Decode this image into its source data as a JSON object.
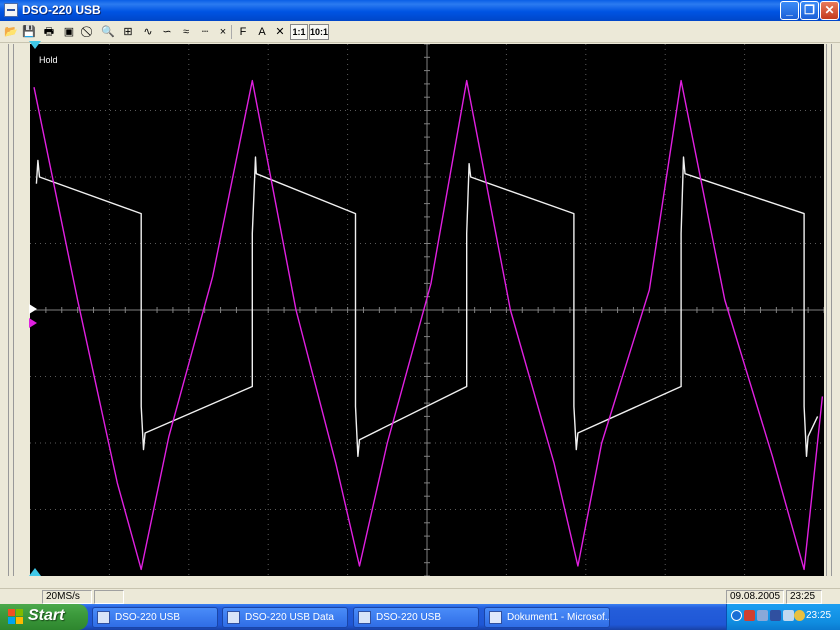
{
  "window": {
    "title": "DSO-220 USB",
    "buttons": {
      "minimize": "_",
      "maximize": "❐",
      "close": "✕"
    }
  },
  "toolbar": {
    "items": [
      {
        "icon": "open-folder-icon",
        "glyph": "📂"
      },
      {
        "icon": "save-icon",
        "glyph": "💾"
      },
      {
        "icon": "print-icon",
        "glyph": "🖶"
      },
      {
        "icon": "device-icon",
        "glyph": "▣"
      },
      {
        "icon": "stop-icon",
        "glyph": "⃠"
      },
      {
        "icon": "zoom-icon",
        "glyph": "🔍"
      },
      {
        "icon": "grid-icon",
        "glyph": "⊞"
      },
      {
        "icon": "wave-icon",
        "glyph": "∿"
      },
      {
        "icon": "wave-alt-icon",
        "glyph": "∽"
      },
      {
        "icon": "wave-dual-icon",
        "glyph": "≈"
      },
      {
        "icon": "dotted-line-icon",
        "glyph": "┄"
      },
      {
        "icon": "marker-x-icon",
        "glyph": "×"
      },
      {
        "icon": "filter-icon",
        "glyph": "F"
      },
      {
        "icon": "cursor-a-icon",
        "glyph": "A"
      },
      {
        "icon": "cross-icon",
        "glyph": "✕"
      }
    ],
    "ratio_1": "1:1",
    "ratio_10": "10:1"
  },
  "scope": {
    "hold_label": "Hold",
    "colors": {
      "background": "#000000",
      "grid": "#5a5a5a",
      "ch1": "#f0f0f0",
      "ch2": "#e020e0",
      "marker": "#40c8e8"
    },
    "chart_data": {
      "type": "line",
      "title": "",
      "xlabel": "",
      "ylabel": "",
      "grid": true,
      "x_divisions": 10,
      "y_divisions": 8,
      "xlim": [
        0,
        10
      ],
      "ylim": [
        -4,
        4
      ],
      "series": [
        {
          "color": "#f0f0f0",
          "x": [
            0.08,
            0.1,
            0.12,
            1.4,
            1.4,
            1.43,
            1.45,
            2.8,
            2.8,
            2.84,
            2.85,
            4.1,
            4.1,
            4.13,
            4.15,
            5.5,
            5.5,
            5.53,
            5.55,
            6.85,
            6.85,
            6.88,
            6.9,
            8.2,
            8.2,
            8.23,
            8.25,
            9.75,
            9.75,
            9.78,
            9.8,
            9.92
          ],
          "y": [
            1.9,
            2.25,
            2.0,
            1.45,
            -1.45,
            -2.1,
            -1.85,
            -1.15,
            1.15,
            2.3,
            2.05,
            1.45,
            -1.45,
            -2.2,
            -1.95,
            -1.15,
            1.15,
            2.2,
            2.0,
            1.45,
            -1.45,
            -2.1,
            -1.85,
            -1.15,
            1.15,
            2.3,
            2.05,
            1.45,
            -1.45,
            -2.2,
            -1.9,
            -1.6
          ]
        },
        {
          "color": "#e020e0",
          "x": [
            0.05,
            0.6,
            1.1,
            1.4,
            1.75,
            2.3,
            2.8,
            3.35,
            3.85,
            4.15,
            4.5,
            5.05,
            5.5,
            6.05,
            6.6,
            6.9,
            7.2,
            7.8,
            8.2,
            8.75,
            9.35,
            9.75,
            9.98
          ],
          "y": [
            3.35,
            0.15,
            -2.6,
            -3.9,
            -1.9,
            0.5,
            3.45,
            0.0,
            -2.3,
            -3.85,
            -2.0,
            0.4,
            3.45,
            0.0,
            -2.3,
            -3.85,
            -2.0,
            0.3,
            3.45,
            0.15,
            -2.2,
            -3.9,
            -1.3
          ]
        }
      ]
    }
  },
  "status": {
    "sample_rate": "20MS/s",
    "date": "09.08.2005",
    "time": "23:25"
  },
  "taskbar": {
    "start_label": "Start",
    "tasks": [
      {
        "label": "DSO-220 USB"
      },
      {
        "label": "DSO-220 USB Data"
      },
      {
        "label": "DSO-220 USB"
      },
      {
        "label": "Dokument1 - Microsof..."
      }
    ],
    "clock": "23:25"
  }
}
